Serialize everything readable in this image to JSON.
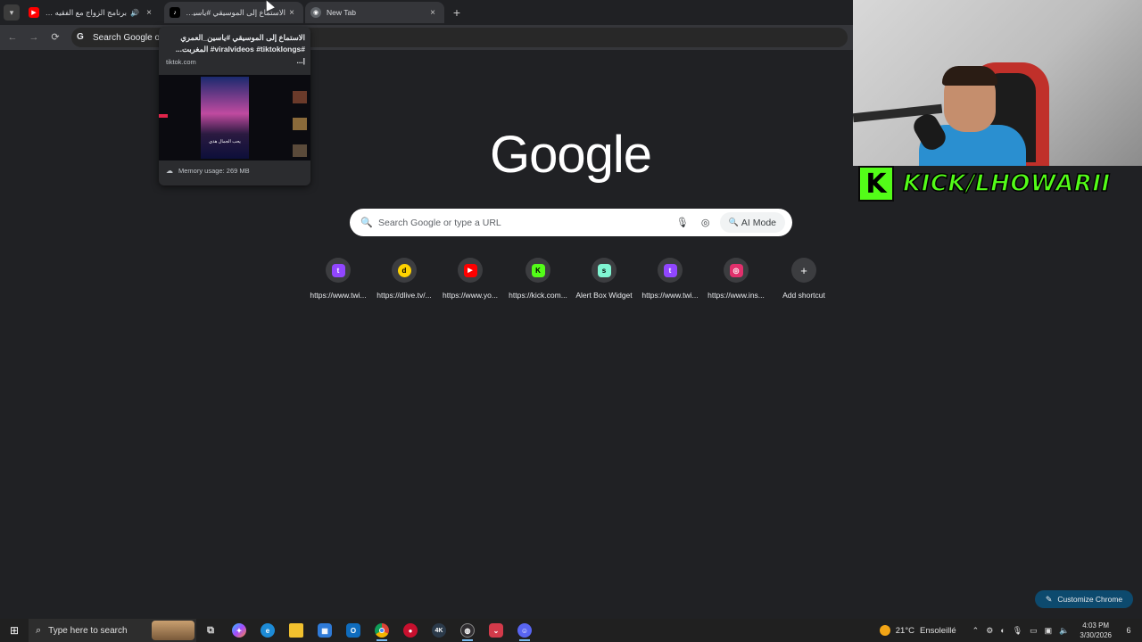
{
  "browser": {
    "tabs": [
      {
        "title": "برنامج الزواج مع الفقيه للبحث...",
        "favicon": "youtube-icon",
        "muted_icon": "speaker-icon",
        "close": "×"
      },
      {
        "title": "الاستماع إلى الموسيقي #ياسين...",
        "favicon": "tiktok-icon",
        "close": "×"
      },
      {
        "title": "New Tab",
        "favicon": "chrome-icon",
        "close": "×"
      }
    ],
    "tab_list_icon": "▾",
    "new_tab_icon": "+",
    "omnibox_text": "Search Google or",
    "nav": {
      "back": "←",
      "forward": "→",
      "reload": "⟳"
    }
  },
  "hover_card": {
    "title": "الاستماع إلى الموسيقي #ياسين_العمري #viralvideos #tiktoklongs# المغربت... |...",
    "domain": "tiktok.com",
    "video_caption": "يحب الجمال هذي",
    "memory": "Memory usage: 269 MB"
  },
  "google": {
    "logo": "Google",
    "search_placeholder": "Search Google or type a URL",
    "ai_mode": "AI Mode",
    "shortcuts": [
      {
        "label": "https://www.twi...",
        "icon": "twitch-icon",
        "color": "#9146ff",
        "glyph": "t"
      },
      {
        "label": "https://dlive.tv/...",
        "icon": "dlive-icon",
        "color": "#ffd300",
        "glyph": "d"
      },
      {
        "label": "https://www.yo...",
        "icon": "youtube-icon",
        "color": "#ff0000",
        "glyph": "▶"
      },
      {
        "label": "https://kick.com...",
        "icon": "kick-icon",
        "color": "#53fc18",
        "glyph": "K"
      },
      {
        "label": "Alert Box Widget",
        "icon": "streamlabs-icon",
        "color": "#80f5d2",
        "glyph": "s"
      },
      {
        "label": "https://www.twi...",
        "icon": "twitch-icon",
        "color": "#9146ff",
        "glyph": "t"
      },
      {
        "label": "https://www.ins...",
        "icon": "instagram-icon",
        "color": "#e1306c",
        "glyph": "◎"
      },
      {
        "label": "Add shortcut",
        "icon": "plus-icon",
        "color": "#3c3d40",
        "glyph": "+"
      }
    ],
    "customize": "Customize Chrome"
  },
  "overlay": {
    "kick_logo": "K",
    "kick_text": "KICK/LHOWARII"
  },
  "taskbar": {
    "search_placeholder": "Type here to search",
    "weather_temp": "21°C",
    "weather_text": "Ensoleillé",
    "time": "4:03 PM",
    "date": "3/30/2026",
    "notifications": "6",
    "apps": [
      {
        "icon": "task-view-icon",
        "glyph": "⧉",
        "color": "#202020"
      },
      {
        "icon": "copilot-icon",
        "glyph": "✦",
        "color": "#7a5cff"
      },
      {
        "icon": "edge-icon",
        "glyph": "e",
        "color": "#1d8bd6"
      },
      {
        "icon": "file-explorer-icon",
        "glyph": "▬",
        "color": "#f2c12e"
      },
      {
        "icon": "store-icon",
        "glyph": "▦",
        "color": "#2f7bd8"
      },
      {
        "icon": "outlook-icon",
        "glyph": "O",
        "color": "#0f6cbd"
      },
      {
        "icon": "chrome-icon",
        "glyph": "◉",
        "color": "#db4437"
      },
      {
        "icon": "app-red-icon",
        "glyph": "●",
        "color": "#c8102e"
      },
      {
        "icon": "app-4k-icon",
        "glyph": "4K",
        "color": "#2b3a4a"
      },
      {
        "icon": "obs-icon",
        "glyph": "◍",
        "color": "#302e31"
      },
      {
        "icon": "app-pocket-icon",
        "glyph": "⌄",
        "color": "#d33a4a"
      },
      {
        "icon": "discord-icon",
        "glyph": "☺",
        "color": "#5865f2"
      }
    ]
  }
}
